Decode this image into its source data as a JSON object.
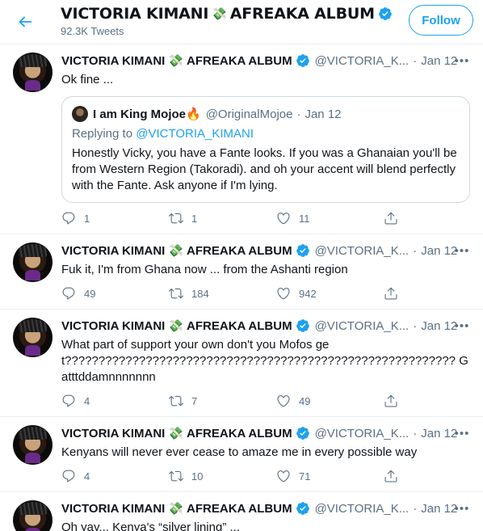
{
  "header": {
    "name": "VICTORIA KIMANI",
    "album": "AFREAKA ALBUM",
    "money_emoji": "💸",
    "tweet_count": "92.3K Tweets",
    "follow_label": "Follow"
  },
  "tweets": [
    {
      "name": "VICTORIA KIMANI",
      "album": "AFREAKA ALBUM",
      "money_emoji": "💸",
      "handle": "@VICTORIA_K...",
      "dot": "·",
      "time": "Jan 12",
      "more": "•••",
      "text": "Ok fine ...",
      "quote": {
        "author": "I am King Mojoe🔥",
        "handle": "@OriginalMojoe",
        "dot": "·",
        "time": "Jan 12",
        "replying_prefix": "Replying to ",
        "replying_to": "@VICTORIA_KIMANI",
        "text": "Honestly Vicky, you have a Fante looks. If you was a Ghanaian you'll be from Western Region (Takoradi). and oh your accent will blend perfectly with the Fante. Ask anyone if I'm lying."
      },
      "replies": "1",
      "retweets": "1",
      "likes": "11"
    },
    {
      "name": "VICTORIA KIMANI",
      "album": "AFREAKA ALBUM",
      "money_emoji": "💸",
      "handle": "@VICTORIA_K...",
      "dot": "·",
      "time": "Jan 12",
      "more": "•••",
      "text": "Fuk it, I'm from Ghana now ... from the Ashanti region",
      "replies": "49",
      "retweets": "184",
      "likes": "942"
    },
    {
      "name": "VICTORIA KIMANI",
      "album": "AFREAKA ALBUM",
      "money_emoji": "💸",
      "handle": "@VICTORIA_K...",
      "dot": "·",
      "time": "Jan 12",
      "more": "•••",
      "text": "What part of support your own don't you Mofos get?????????????????????????????????????????????????????????? Gatttddamnnnnnnn",
      "replies": "4",
      "retweets": "7",
      "likes": "49"
    },
    {
      "name": "VICTORIA KIMANI",
      "album": "AFREAKA ALBUM",
      "money_emoji": "💸",
      "handle": "@VICTORIA_K...",
      "dot": "·",
      "time": "Jan 12",
      "more": "•••",
      "text": "Kenyans will never ever cease to amaze me in every possible way",
      "replies": "4",
      "retweets": "10",
      "likes": "71"
    },
    {
      "name": "VICTORIA KIMANI",
      "album": "AFREAKA ALBUM",
      "money_emoji": "💸",
      "handle": "@VICTORIA_K...",
      "dot": "·",
      "time": "Jan 12",
      "more": "•••",
      "text": "Oh yay... Kenya's “silver lining” ..."
    }
  ],
  "colors": {
    "accent": "#1da1f2",
    "text": "#0f1419",
    "muted": "#5b7083",
    "border": "#ebeef0"
  },
  "icons": {
    "back": "back-arrow-icon",
    "verified": "verified-badge-icon",
    "reply": "reply-icon",
    "retweet": "retweet-icon",
    "like": "heart-icon",
    "share": "share-icon",
    "more": "more-icon"
  }
}
